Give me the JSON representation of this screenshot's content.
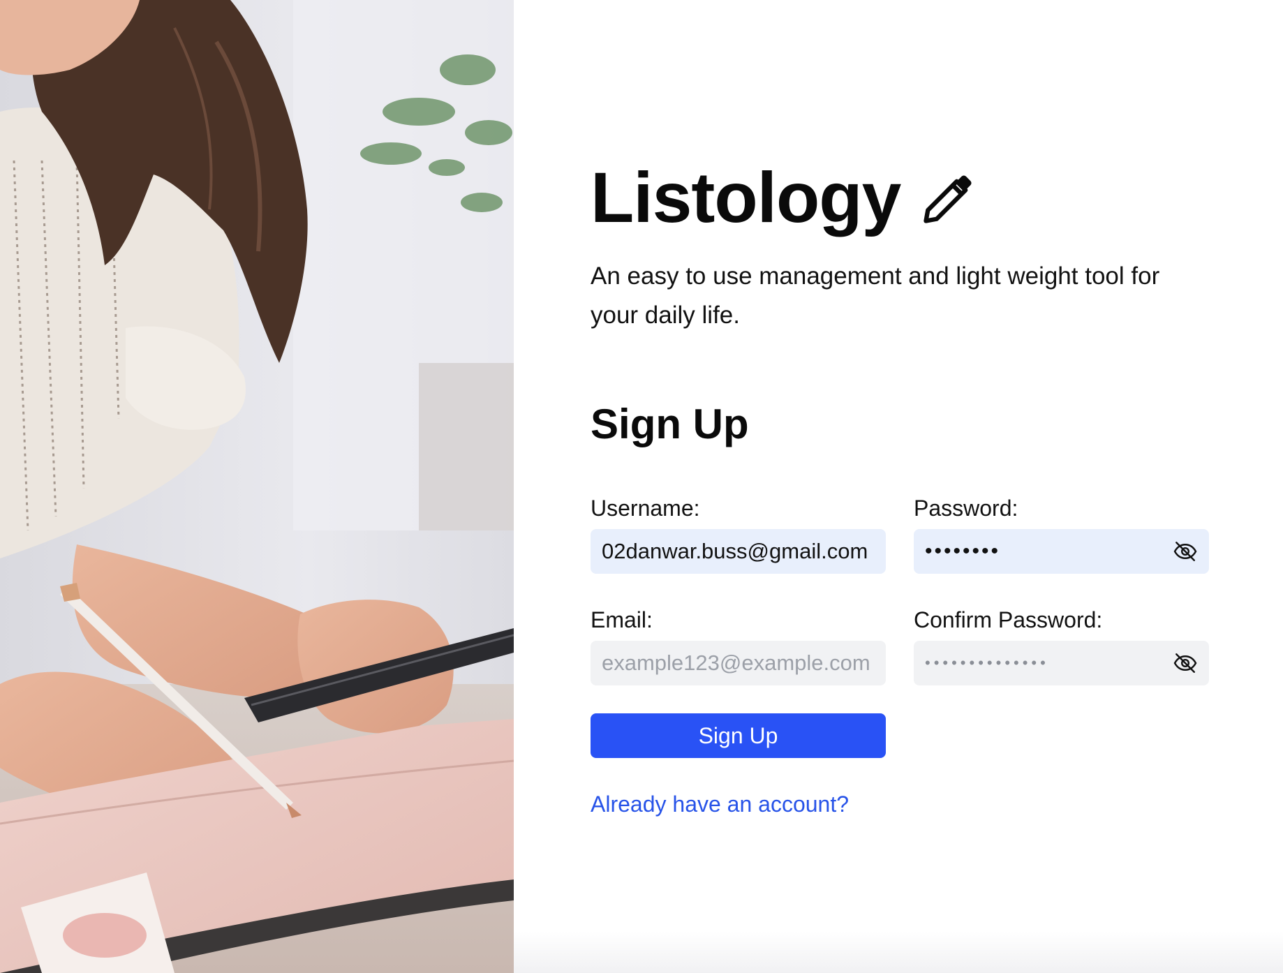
{
  "hero_image": {
    "description_icon": "woman-writing-in-planner-photo"
  },
  "brand": {
    "title": "Listology",
    "icon": "pencil-icon"
  },
  "tagline": "An easy to use management and light weight tool for your daily life.",
  "form": {
    "heading": "Sign Up",
    "username": {
      "label": "Username:",
      "value": "02danwar.buss@gmail.com",
      "placeholder": ""
    },
    "password": {
      "label": "Password:",
      "masked_value": "••••••••",
      "toggle_icon": "eye-slash-icon"
    },
    "email": {
      "label": "Email:",
      "value": "",
      "placeholder": "example123@example.com"
    },
    "confirm_password": {
      "label": "Confirm Password:",
      "placeholder_dots": "••••••••••••••",
      "toggle_icon": "eye-slash-icon"
    },
    "submit_label": "Sign Up",
    "login_link": "Already have an account?"
  },
  "colors": {
    "primary_button": "#2952f5",
    "link": "#2753e8",
    "filled_input_bg": "#e8effc",
    "empty_input_bg": "#f1f2f4"
  }
}
